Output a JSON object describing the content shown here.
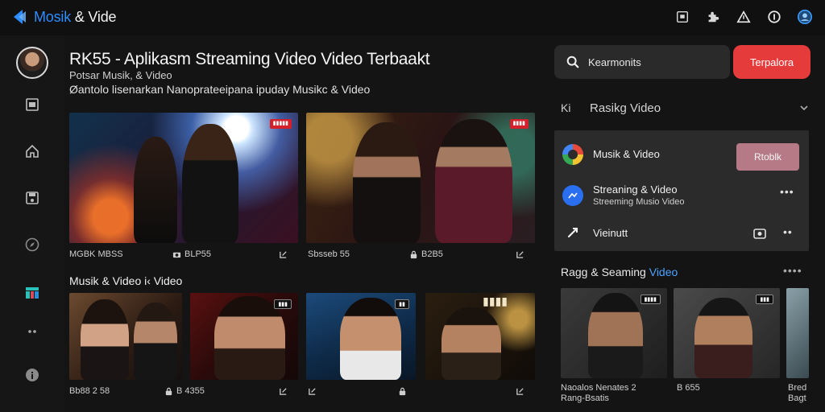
{
  "app": {
    "brand_prefix": "Mosik",
    "brand_suffix": " & Vide",
    "accent_color": "#2d8cff"
  },
  "topbar": {
    "icons": [
      "window-icon",
      "puzzle-icon",
      "alert-icon",
      "circle-badge-icon",
      "account-circle-icon"
    ]
  },
  "sidebar": {
    "icons": [
      "library-icon",
      "home-icon",
      "save-icon",
      "explore-icon",
      "charts-icon",
      "more-dots-icon",
      "info-icon"
    ]
  },
  "header": {
    "title": "RK55 - Aplikasm Streaming Video Video Terbaakt",
    "subtitle": "Potsar Musik, & Video",
    "description": "Øantolo lisenarkan Nanoprateeipana ipuday Musikc & Video"
  },
  "featured": [
    {
      "badge": "▮▮▮▮▮",
      "meta": [
        "MGBK MBSS",
        "BLP55",
        ""
      ]
    },
    {
      "badge": "▮▮▮▮",
      "meta": [
        "Sbsseb 55",
        "B2B5",
        ""
      ]
    }
  ],
  "section": {
    "title": "Musik & Video i‹ Video"
  },
  "grid": [
    {
      "caption": "Bb88 2 58",
      "meta": "B 4355"
    },
    {
      "caption": "",
      "meta": ""
    },
    {
      "caption": "",
      "meta": ""
    },
    {
      "caption": "",
      "meta": ""
    }
  ],
  "search": {
    "placeholder": "Kearmonits",
    "button_label": "Terpalora"
  },
  "filter": {
    "prefix": "Ki",
    "label": "Rasikg Video"
  },
  "panel": {
    "rows": [
      {
        "title": "Musik & Video",
        "button": "Rtoblk"
      },
      {
        "title": "Streaning & Video",
        "subtitle": "Streeming Musio Video"
      },
      {
        "title": "Vieinutt"
      }
    ]
  },
  "right_section": {
    "title_prefix": "Ragg & Seaming ",
    "title_accent": "Video"
  },
  "right_cards": [
    {
      "caption_line1": "Naoalos Nenates 2",
      "caption_line2": "Rang-Bsatis",
      "meta": "B 655"
    },
    {
      "caption_line1": "Bred",
      "caption_line2": "Bagt"
    }
  ]
}
